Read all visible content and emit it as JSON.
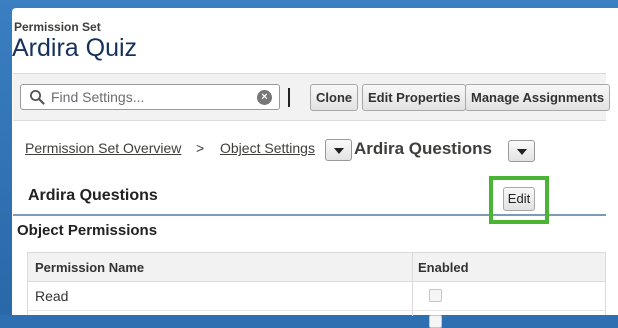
{
  "header": {
    "eyebrow": "Permission Set",
    "title": "Ardira Quiz"
  },
  "toolbar": {
    "search_placeholder": "Find Settings...",
    "search_value": "",
    "clone_label": "Clone",
    "edit_properties_label": "Edit Properties",
    "manage_assignments_label": "Manage Assignments"
  },
  "breadcrumb": {
    "overview": "Permission Set Overview",
    "separator": ">",
    "object_settings": "Object Settings",
    "current": "Ardira Questions"
  },
  "section": {
    "title": "Ardira Questions",
    "edit_label": "Edit"
  },
  "object_permissions": {
    "title": "Object Permissions",
    "columns": [
      "Permission Name",
      "Enabled"
    ],
    "rows": [
      {
        "name": "Read",
        "enabled": false
      },
      {
        "name": "",
        "enabled": false
      }
    ]
  },
  "colors": {
    "highlight": "#4ab434",
    "title": "#16325c",
    "background": "#2d6fb0"
  }
}
